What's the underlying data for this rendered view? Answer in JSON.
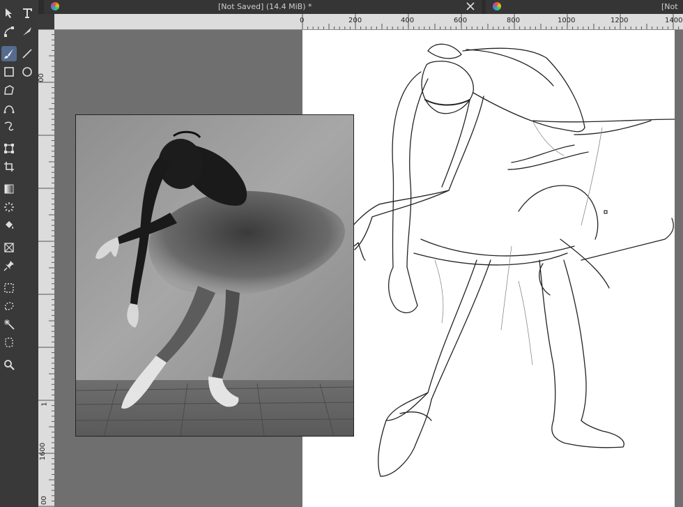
{
  "tabs": [
    {
      "title": "[Not Saved]  (14.4 MiB) *",
      "close_icon": "close-icon"
    },
    {
      "title": "[Not"
    }
  ],
  "ruler_top": {
    "labels": [
      "0",
      "200",
      "400",
      "600",
      "800",
      "1000",
      "1200",
      "1400"
    ]
  },
  "ruler_left": {
    "labels": [
      "00",
      "1",
      "1600",
      "00"
    ]
  },
  "toolbox": {
    "tools": [
      {
        "name": "select-shapes-icon"
      },
      {
        "name": "text-icon"
      },
      {
        "name": "edit-shapes-icon"
      },
      {
        "name": "calligraphy-icon"
      },
      {
        "name": "freehand-brush-icon"
      },
      {
        "name": "line-icon"
      },
      {
        "name": "rectangle-icon"
      },
      {
        "name": "ellipse-icon"
      },
      {
        "name": "polygon-icon"
      },
      {
        "name": "bezier-curve-icon"
      },
      {
        "name": "freehand-path-icon"
      },
      {
        "name": "transform-icon"
      },
      {
        "name": "crop-icon"
      },
      {
        "name": "gradient-icon"
      },
      {
        "name": "color-sampler-icon"
      },
      {
        "name": "fill-icon"
      },
      {
        "name": "assistant-icon"
      },
      {
        "name": "reference-pin-icon"
      },
      {
        "name": "rect-select-icon"
      },
      {
        "name": "freehand-select-icon"
      },
      {
        "name": "magic-wand-icon"
      },
      {
        "name": "bezier-select-icon"
      },
      {
        "name": "zoom-icon"
      }
    ],
    "active_color": "#556b8f"
  },
  "colors": {
    "canvas_bg": "#6f6f6f",
    "paper": "#ffffff",
    "toolbar": "#393939"
  }
}
